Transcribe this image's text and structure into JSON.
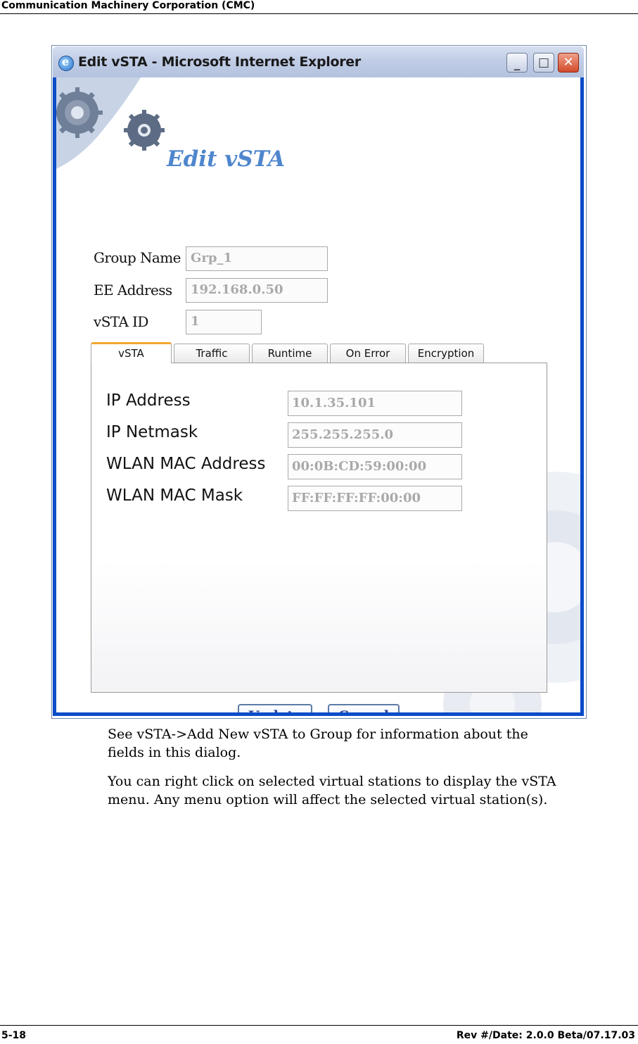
{
  "header": {
    "text": "Communication Machinery Corporation (CMC)"
  },
  "window": {
    "title": "Edit vSTA - Microsoft Internet Explorer",
    "minimize_glyph": "_",
    "maximize_glyph": "□",
    "close_glyph": "✕",
    "icons": {
      "app": "internet-explorer-icon",
      "decor": "gear-icon"
    }
  },
  "form": {
    "title": "Edit vSTA",
    "fields": [
      {
        "label": "Group Name",
        "value": "Grp_1"
      },
      {
        "label": "EE Address",
        "value": "192.168.0.50"
      },
      {
        "label": "vSTA ID",
        "value": "1"
      }
    ]
  },
  "tabs": [
    {
      "label": "vSTA",
      "active": true
    },
    {
      "label": "Traffic",
      "active": false
    },
    {
      "label": "Runtime",
      "active": false
    },
    {
      "label": "On Error",
      "active": false
    },
    {
      "label": "Encryption",
      "active": false
    }
  ],
  "vsta_panel": {
    "fields": [
      {
        "label": "IP Address",
        "value": "10.1.35.101"
      },
      {
        "label": "IP Netmask",
        "value": "255.255.255.0"
      },
      {
        "label": "WLAN MAC Address",
        "value": "00:0B:CD:59:00:00"
      },
      {
        "label": "WLAN MAC Mask",
        "value": "FF:FF:FF:FF:00:00"
      }
    ]
  },
  "buttons": {
    "update": "Update",
    "cancel": "Cancel"
  },
  "body": {
    "para1_line1": "See vSTA->Add New vSTA to Group for information about the",
    "para1_line2": "fields in this dialog.",
    "para2_line1": "You can right click on selected virtual stations to display the vSTA",
    "para2_line2": "menu. Any menu option will affect the selected virtual station(s)."
  },
  "footer": {
    "left": "5-18",
    "right": "Rev #/Date: 2.0.0 Beta/07.17.03"
  },
  "colors": {
    "title_blue": "#4f86cd",
    "button_text": "#2a3f9a",
    "tab_active": "#f0a830"
  }
}
